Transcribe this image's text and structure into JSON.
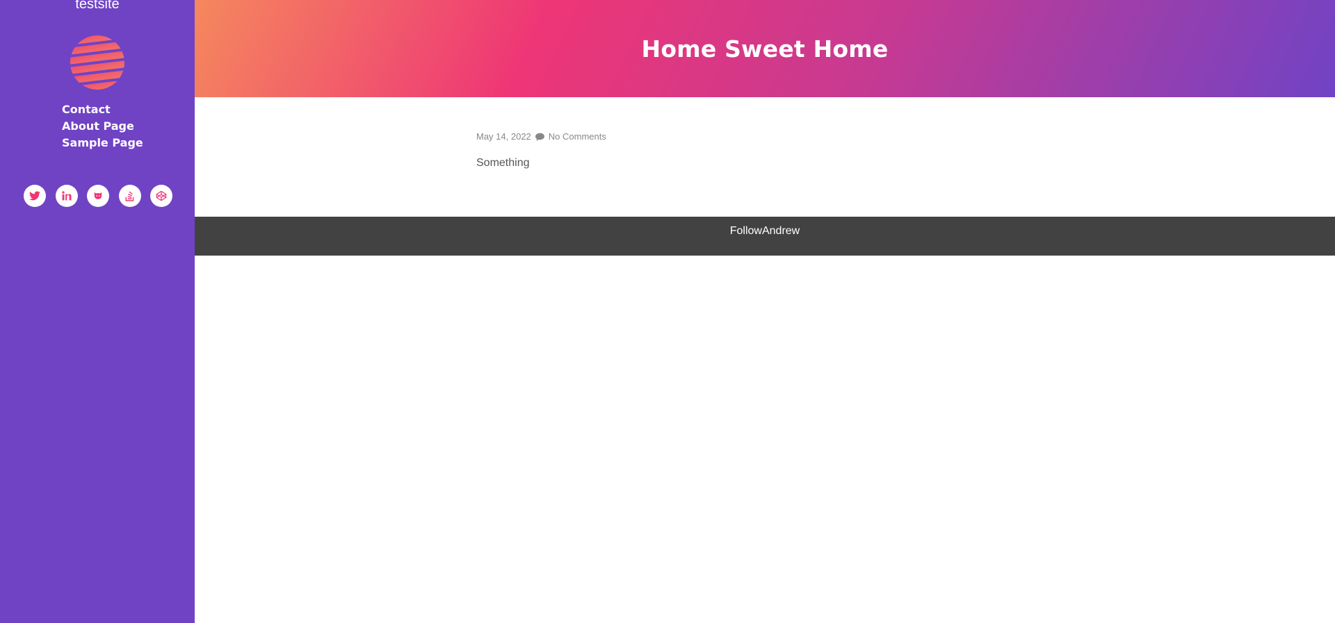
{
  "site": {
    "title": "testsite"
  },
  "nav": {
    "items": [
      "Contact",
      "About Page",
      "Sample Page"
    ]
  },
  "social": {
    "icons": [
      "twitter-icon",
      "linkedin-icon",
      "github-icon",
      "stackoverflow-icon",
      "codepen-icon"
    ]
  },
  "hero": {
    "title": "Home Sweet Home"
  },
  "post": {
    "date": "May 14, 2022",
    "comments": "No Comments",
    "content": "Something"
  },
  "footer": {
    "text": "FollowAndrew"
  },
  "colors": {
    "sidebar": "#7043c5",
    "accent": "#ee3676",
    "footer": "#424242"
  }
}
